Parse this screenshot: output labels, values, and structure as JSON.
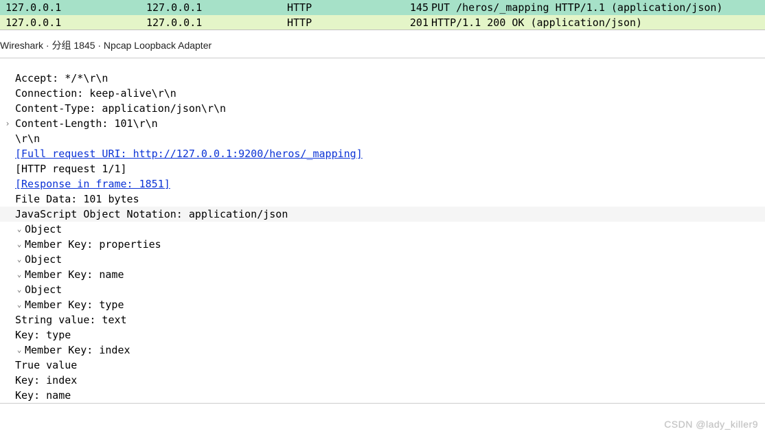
{
  "packet_list": [
    {
      "src": "127.0.0.1",
      "dst": "127.0.0.1",
      "proto": "HTTP",
      "len": "145",
      "info": "PUT /heros/_mapping HTTP/1.1  (application/json)"
    },
    {
      "src": "127.0.0.1",
      "dst": "127.0.0.1",
      "proto": "HTTP",
      "len": "201",
      "info": "HTTP/1.1 200 OK  (application/json)"
    }
  ],
  "context_title": "Wireshark · 分组 1845 · Npcap Loopback Adapter",
  "details": {
    "accept": "Accept: */*\\r\\n",
    "connection": "Connection: keep-alive\\r\\n",
    "content_type": "Content-Type: application/json\\r\\n",
    "content_length": "Content-Length: 101\\r\\n",
    "crlf": "\\r\\n",
    "full_uri": "[Full request URI: http://127.0.0.1:9200/heros/_mapping]",
    "http_request": "[HTTP request 1/1]",
    "response_frame": "[Response in frame: 1851]",
    "file_data": "File Data: 101 bytes",
    "json_header": "JavaScript Object Notation: application/json",
    "json_tree": {
      "object": "Object",
      "member_properties": "Member Key: properties",
      "object2": "Object",
      "member_name": "Member Key: name",
      "object3": "Object",
      "member_type": "Member Key: type",
      "string_value_text": "String value: text",
      "key_type": "Key: type",
      "member_index": "Member Key: index",
      "true_value": "True value",
      "key_index": "Key: index",
      "key_name": "Key: name"
    }
  },
  "watermark": "CSDN @lady_killer9"
}
